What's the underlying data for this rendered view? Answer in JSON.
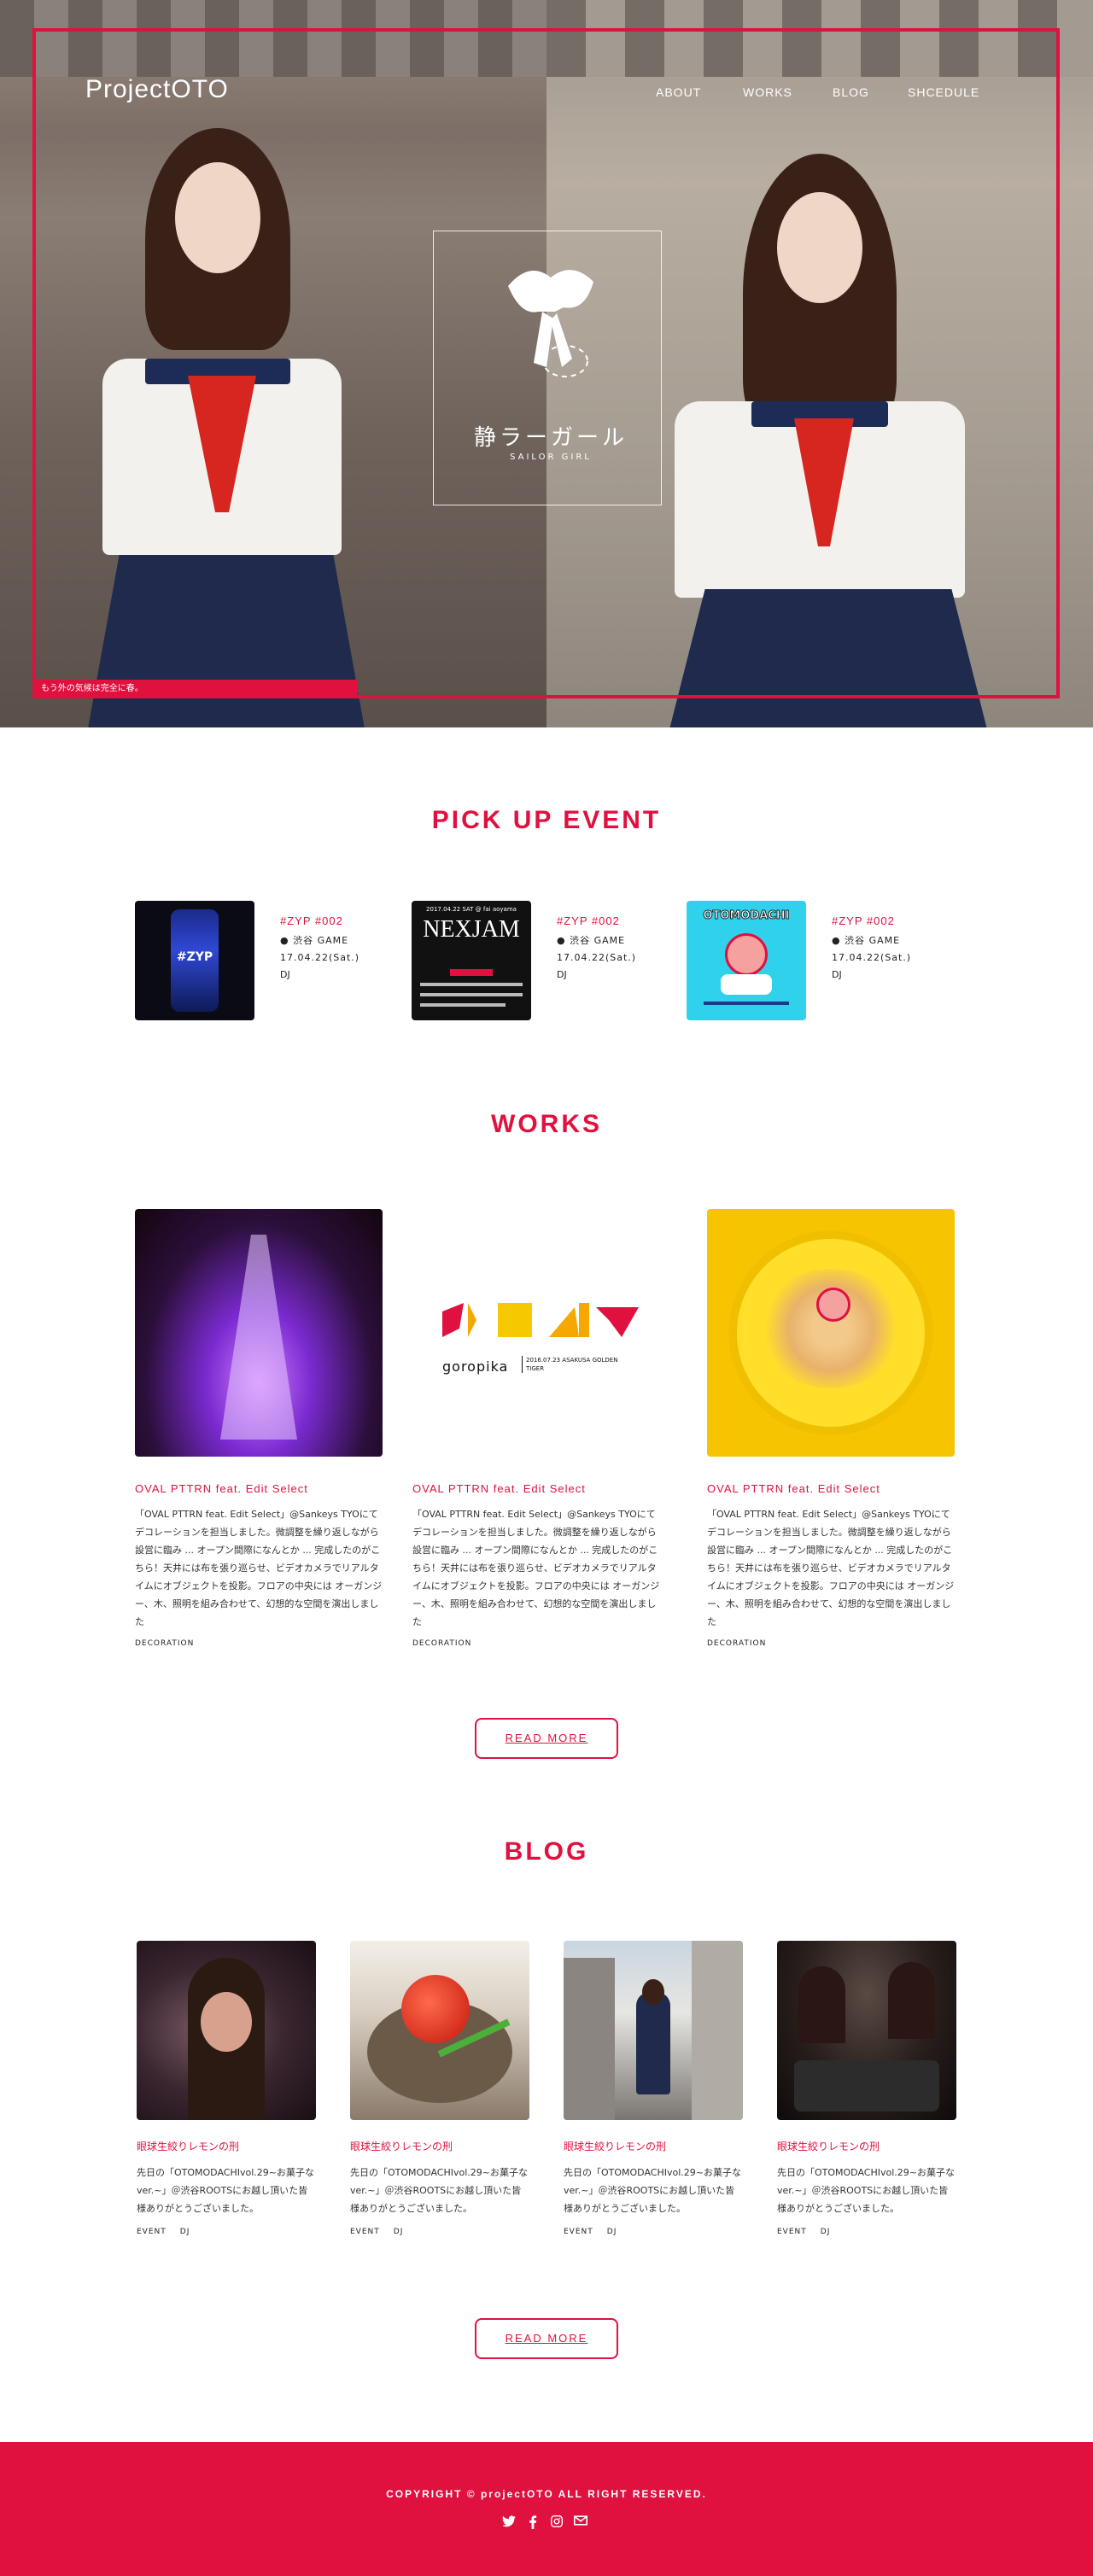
{
  "header": {
    "logo": "ProjectOTO",
    "nav": [
      "ABOUT",
      "WORKS",
      "BLOG",
      "SHCEDULE"
    ]
  },
  "hero": {
    "title": "静ラーガール",
    "subtitle": "SAILOR GIRL",
    "caption": "もう外の気候は完全に春。"
  },
  "pickup": {
    "title": "PICK UP EVENT",
    "events": [
      {
        "tag": "#ZYP #002",
        "venue": "渋谷 GAME",
        "date": "17.04.22(Sat.)",
        "type": "DJ",
        "poster_text": "#ZYP"
      },
      {
        "tag": "#ZYP #002",
        "venue": "渋谷 GAME",
        "date": "17.04.22(Sat.)",
        "type": "DJ",
        "poster_text": "NEXJAM",
        "poster_date": "2017.04.22 SAT @ fai aoyama"
      },
      {
        "tag": "#ZYP #002",
        "venue": "渋谷 GAME",
        "date": "17.04.22(Sat.)",
        "type": "DJ",
        "poster_text": "OTOMODACHI"
      }
    ]
  },
  "works": {
    "title": "WORKS",
    "items": [
      {
        "title": "OVAL PTTRN feat. Edit Select",
        "desc": "「OVAL PTTRN feat. Edit Select」@Sankeys TYOにてデコレーションを担当しました。微調整を繰り返しながら設営に臨み ... オープン間際になんとか ... 完成したのがこちら！天井には布を張り巡らせ、ビデオカメラでリアルタイムにオブジェクトを投影。フロアの中央には オーガンジー、木、照明を組み合わせて、幻想的な空間を演出しました",
        "category": "DECORATION"
      },
      {
        "title": "OVAL PTTRN feat. Edit Select",
        "desc": "「OVAL PTTRN feat. Edit Select」@Sankeys TYOにてデコレーションを担当しました。微調整を繰り返しながら設営に臨み ... オープン間際になんとか ... 完成したのがこちら！天井には布を張り巡らせ、ビデオカメラでリアルタイムにオブジェクトを投影。フロアの中央には オーガンジー、木、照明を組み合わせて、幻想的な空間を演出しました",
        "category": "DECORATION",
        "logo_text": "goropika",
        "logo_sub": "2016.07.23 ASAKUSA GOLDEN TIGER"
      },
      {
        "title": "OVAL PTTRN feat. Edit Select",
        "desc": "「OVAL PTTRN feat. Edit Select」@Sankeys TYOにてデコレーションを担当しました。微調整を繰り返しながら設営に臨み ... オープン間際になんとか ... 完成したのがこちら！天井には布を張り巡らせ、ビデオカメラでリアルタイムにオブジェクトを投影。フロアの中央には オーガンジー、木、照明を組み合わせて、幻想的な空間を演出しました",
        "category": "DECORATION"
      }
    ],
    "read_more": "READ MORE"
  },
  "blog": {
    "title": "BLOG",
    "posts": [
      {
        "title": "眼球生絞りレモンの刑",
        "desc": "先日の「OTOMODACHIvol.29~お菓子なver.~」＠渋谷ROOTSにお越し頂いた皆様ありがとうございました。",
        "tags": [
          "EVENT",
          "DJ"
        ]
      },
      {
        "title": "眼球生絞りレモンの刑",
        "desc": "先日の「OTOMODACHIvol.29~お菓子なver.~」＠渋谷ROOTSにお越し頂いた皆様ありがとうございました。",
        "tags": [
          "EVENT",
          "DJ"
        ]
      },
      {
        "title": "眼球生絞りレモンの刑",
        "desc": "先日の「OTOMODACHIvol.29~お菓子なver.~」＠渋谷ROOTSにお越し頂いた皆様ありがとうございました。",
        "tags": [
          "EVENT",
          "DJ"
        ]
      },
      {
        "title": "眼球生絞りレモンの刑",
        "desc": "先日の「OTOMODACHIvol.29~お菓子なver.~」＠渋谷ROOTSにお越し頂いた皆様ありがとうございました。",
        "tags": [
          "EVENT",
          "DJ"
        ]
      }
    ],
    "read_more": "READ MORE"
  },
  "footer": {
    "copyright": "COPYRIGHT © projectOTO ALL RIGHT RESERVED.",
    "social_icons": [
      "twitter-icon",
      "facebook-icon",
      "instagram-icon",
      "mail-icon"
    ]
  },
  "colors": {
    "accent": "#e0103f",
    "footer_bg": "#e0103f"
  }
}
